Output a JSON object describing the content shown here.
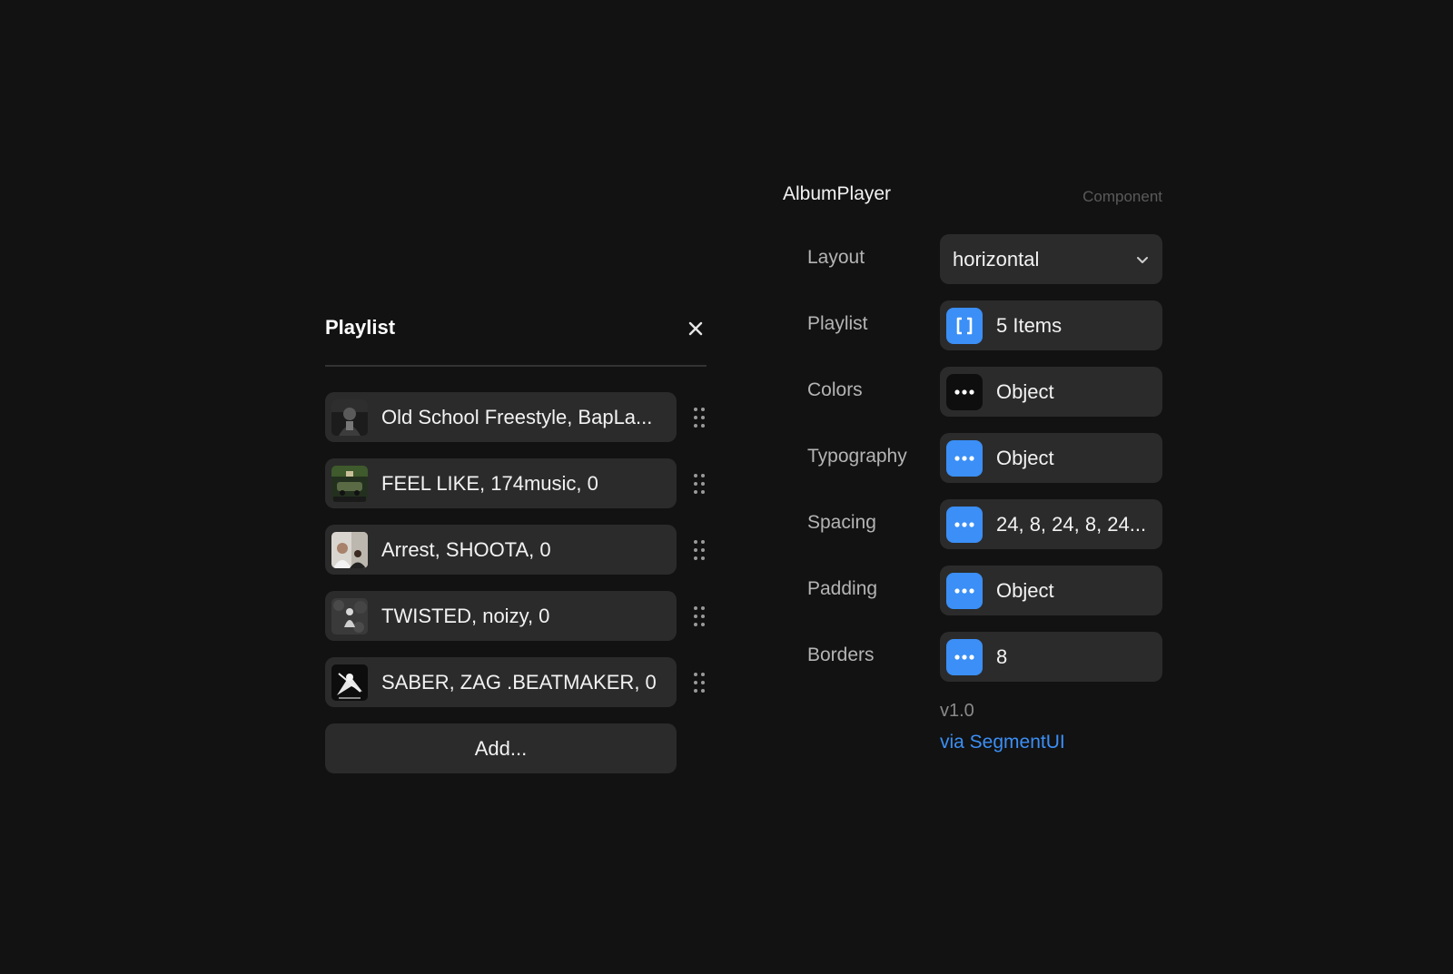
{
  "playlist": {
    "title": "Playlist",
    "items": [
      {
        "label": "Old School Freestyle, BapLa...",
        "thumb": "album-cover-dark-icon"
      },
      {
        "label": "FEEL LIKE, 174music, 0",
        "thumb": "album-cover-car-icon"
      },
      {
        "label": "Arrest, SHOOTA, 0",
        "thumb": "album-cover-people-icon"
      },
      {
        "label": "TWISTED, noizy, 0",
        "thumb": "album-cover-figure-icon"
      },
      {
        "label": "SABER, ZAG .BEATMAKER, 0",
        "thumb": "album-cover-warrior-icon"
      }
    ],
    "add_label": "Add..."
  },
  "component": {
    "name": "AlbumPlayer",
    "type": "Component",
    "props": {
      "layout": {
        "label": "Layout",
        "value": "horizontal"
      },
      "playlist": {
        "label": "Playlist",
        "value": "5 Items",
        "icon": "array-brackets-icon"
      },
      "colors": {
        "label": "Colors",
        "value": "Object",
        "icon": "ellipsis-icon"
      },
      "typography": {
        "label": "Typography",
        "value": "Object",
        "icon": "ellipsis-icon"
      },
      "spacing": {
        "label": "Spacing",
        "value": "24, 8, 24, 8, 24...",
        "icon": "ellipsis-icon"
      },
      "padding": {
        "label": "Padding",
        "value": "Object",
        "icon": "ellipsis-icon"
      },
      "borders": {
        "label": "Borders",
        "value": "8",
        "icon": "ellipsis-icon"
      }
    },
    "version": "v1.0",
    "via": "via SegmentUI"
  },
  "colors": {
    "background": "#121212",
    "surface": "#2b2b2b",
    "accent": "#3b8ff6",
    "label": "#b4b4b4",
    "muted": "#5a5a5a"
  }
}
